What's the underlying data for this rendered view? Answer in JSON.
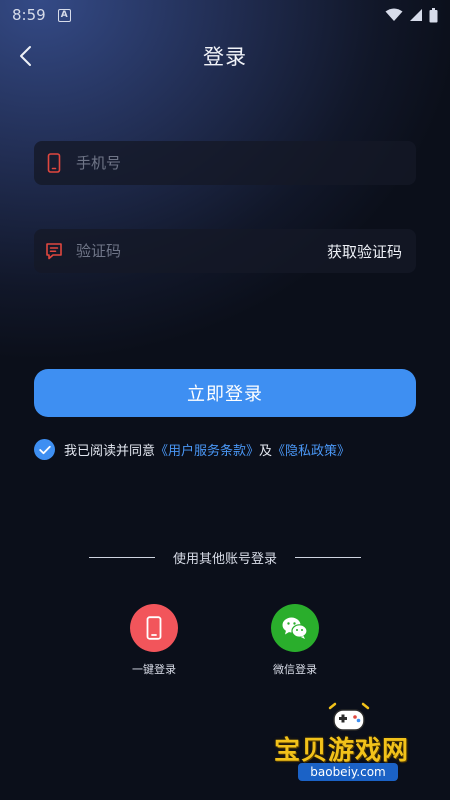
{
  "status_bar": {
    "time": "8:59",
    "a_icon": "A"
  },
  "nav": {
    "title": "登录"
  },
  "phone_field": {
    "placeholder": "手机号",
    "value": ""
  },
  "code_field": {
    "placeholder": "验证码",
    "value": "",
    "get_code_label": "获取验证码"
  },
  "login_button": {
    "label": "立即登录"
  },
  "agreement": {
    "checked": true,
    "prefix": "我已阅读并同意",
    "terms_link": "《用户服务条款》",
    "and": "及",
    "privacy_link": "《隐私政策》"
  },
  "other_login": {
    "label": "使用其他账号登录",
    "one_click": {
      "label": "一键登录",
      "color": "#f2555b"
    },
    "wechat": {
      "label": "微信登录",
      "color": "#2aae2c"
    }
  },
  "watermark": {
    "brand": "宝贝游戏网",
    "url": "baobeiy.com"
  },
  "colors": {
    "accent": "#3e8ff2",
    "icon_red": "#e0473f"
  }
}
